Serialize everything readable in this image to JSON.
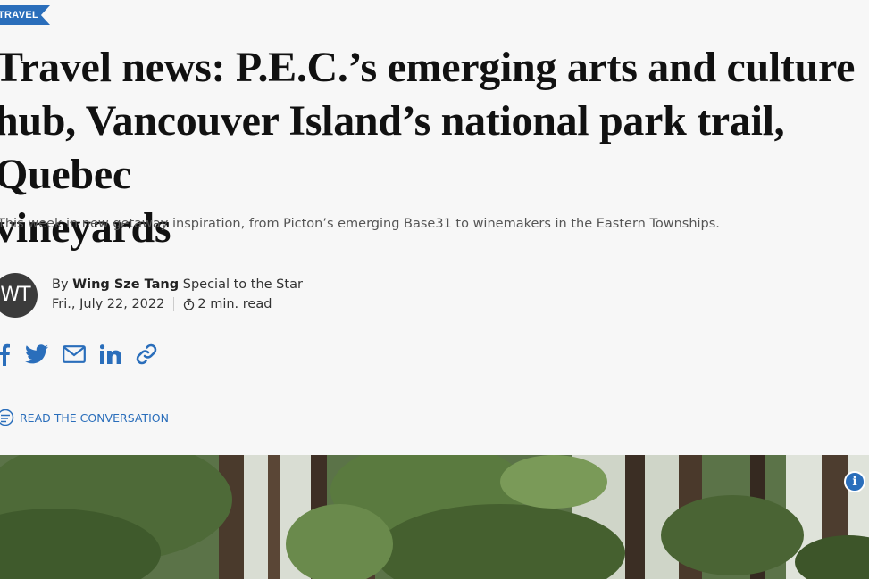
{
  "section_tag": "TRAVEL",
  "headline": {
    "line1": "Travel news: P.E.C.’s emerging arts and culture",
    "line2": "hub, Vancouver Island’s national park trail, Quebec",
    "line3": "vineyards"
  },
  "dek": "This week in new getaway inspiration, from Picton’s emerging Base31 to winemakers in the Eastern Townships.",
  "author": {
    "initials": "WT",
    "by": "By",
    "name": "Wing Sze Tang",
    "role": "Special to the Star"
  },
  "meta": {
    "date": "Fri., July 22, 2022",
    "read_time": "2 min. read"
  },
  "share_icons": [
    "facebook-icon",
    "twitter-icon",
    "email-icon",
    "linkedin-icon",
    "link-icon"
  ],
  "conversation_link": "READ THE CONVERSATION",
  "info_button": "i",
  "colors": {
    "accent": "#2a6ebb",
    "text": "#111111",
    "muted": "#555555",
    "background": "#f7f7f7"
  }
}
